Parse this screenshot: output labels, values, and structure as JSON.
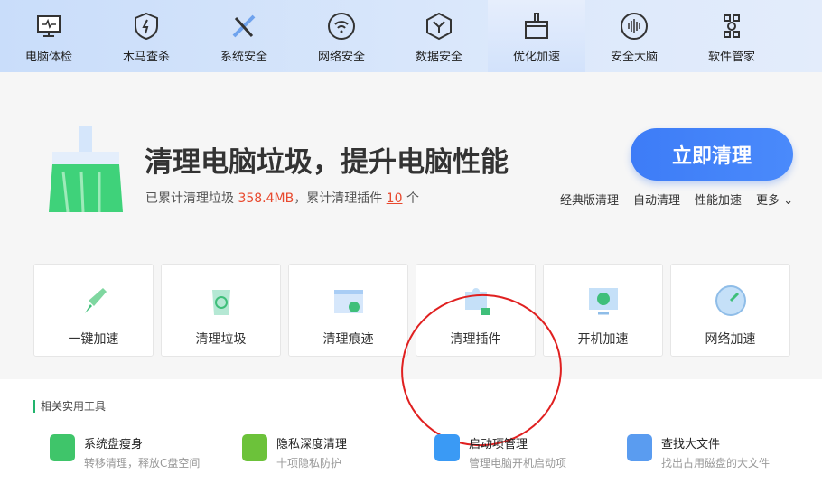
{
  "nav": [
    {
      "label": "电脑体检",
      "icon": "monitor-pulse-icon"
    },
    {
      "label": "木马查杀",
      "icon": "shield-bolt-icon"
    },
    {
      "label": "系统安全",
      "icon": "wrench-icon"
    },
    {
      "label": "网络安全",
      "icon": "wifi-icon"
    },
    {
      "label": "数据安全",
      "icon": "hexagon-icon"
    },
    {
      "label": "优化加速",
      "icon": "broom-icon"
    },
    {
      "label": "安全大脑",
      "icon": "brain-icon"
    },
    {
      "label": "软件管家",
      "icon": "apps-icon"
    }
  ],
  "hero": {
    "title": "清理电脑垃圾，提升电脑性能",
    "sub_prefix": "已累计清理垃圾",
    "junk": "358.4MB",
    "sub_mid": "，累计清理插件",
    "plugins": "10",
    "sub_suffix": "个",
    "button": "立即清理",
    "links": [
      "经典版清理",
      "自动清理",
      "性能加速",
      "更多"
    ]
  },
  "cards": [
    {
      "label": "一键加速",
      "icon": "rocket-icon"
    },
    {
      "label": "清理垃圾",
      "icon": "recycle-bin-icon"
    },
    {
      "label": "清理痕迹",
      "icon": "browser-trace-icon"
    },
    {
      "label": "清理插件",
      "icon": "puzzle-icon"
    },
    {
      "label": "开机加速",
      "icon": "power-monitor-icon"
    },
    {
      "label": "网络加速",
      "icon": "speedometer-icon"
    }
  ],
  "tools": {
    "heading": "相关实用工具",
    "items": [
      {
        "name": "系统盘瘦身",
        "desc": "转移清理，释放C盘空间",
        "color": "#3fc56a"
      },
      {
        "name": "隐私深度清理",
        "desc": "十项隐私防护",
        "color": "#6cc23a"
      },
      {
        "name": "启动项管理",
        "desc": "管理电脑开机启动项",
        "color": "#3a9af5"
      },
      {
        "name": "查找大文件",
        "desc": "找出占用磁盘的大文件",
        "color": "#5a9cf0"
      }
    ]
  }
}
